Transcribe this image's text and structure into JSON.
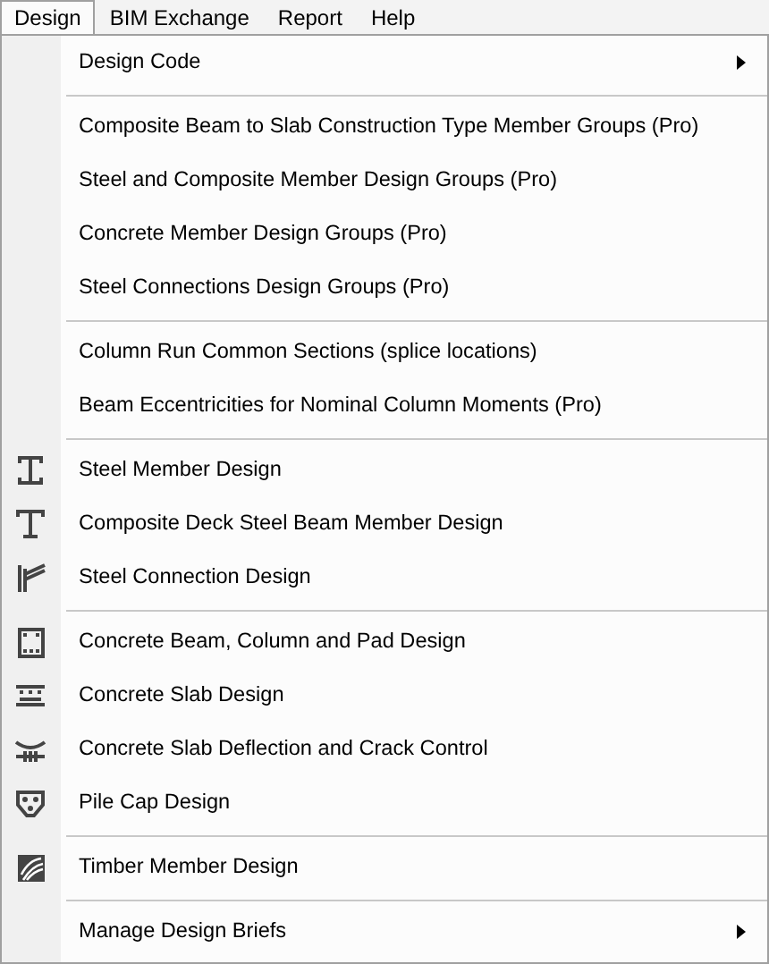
{
  "menubar": [
    {
      "label": "Design",
      "selected": true
    },
    {
      "label": "BIM Exchange",
      "selected": false
    },
    {
      "label": "Report",
      "selected": false
    },
    {
      "label": "Help",
      "selected": false
    }
  ],
  "menu": {
    "sections": [
      {
        "items": [
          {
            "label": "Design Code",
            "icon": false,
            "submenu": true
          }
        ]
      },
      {
        "items": [
          {
            "label": "Composite Beam to Slab Construction Type Member Groups (Pro)",
            "icon": false,
            "submenu": false
          },
          {
            "label": "Steel and Composite Member Design Groups (Pro)",
            "icon": false,
            "submenu": false
          },
          {
            "label": "Concrete Member Design Groups (Pro)",
            "icon": false,
            "submenu": false
          },
          {
            "label": "Steel Connections Design Groups (Pro)",
            "icon": false,
            "submenu": false
          }
        ]
      },
      {
        "items": [
          {
            "label": "Column Run Common Sections (splice locations)",
            "icon": false,
            "submenu": false
          },
          {
            "label": "Beam Eccentricities for Nominal Column Moments (Pro)",
            "icon": false,
            "submenu": false
          }
        ]
      },
      {
        "items": [
          {
            "label": "Steel Member Design",
            "icon": true,
            "submenu": false
          },
          {
            "label": "Composite Deck Steel Beam Member Design",
            "icon": true,
            "submenu": false
          },
          {
            "label": "Steel Connection Design",
            "icon": true,
            "submenu": false
          }
        ]
      },
      {
        "items": [
          {
            "label": "Concrete Beam, Column and Pad Design",
            "icon": true,
            "submenu": false
          },
          {
            "label": "Concrete Slab Design",
            "icon": true,
            "submenu": false
          },
          {
            "label": "Concrete Slab Deflection and Crack Control",
            "icon": true,
            "submenu": false
          },
          {
            "label": "Pile Cap Design",
            "icon": true,
            "submenu": false
          }
        ]
      },
      {
        "items": [
          {
            "label": "Timber Member Design",
            "icon": true,
            "submenu": false
          }
        ]
      },
      {
        "items": [
          {
            "label": "Manage Design Briefs",
            "icon": false,
            "submenu": true
          }
        ]
      }
    ]
  }
}
